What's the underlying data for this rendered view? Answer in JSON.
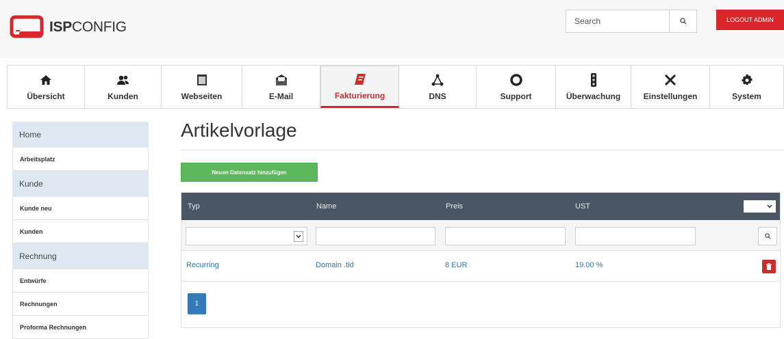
{
  "brand": {
    "bold": "ISP",
    "rest": "CONFIG"
  },
  "search": {
    "placeholder": "Search"
  },
  "logout_label": "LOGOUT ADMIN",
  "nav": [
    {
      "label": "Übersicht",
      "icon": "home-icon"
    },
    {
      "label": "Kunden",
      "icon": "users-icon"
    },
    {
      "label": "Webseiten",
      "icon": "browser-icon"
    },
    {
      "label": "E-Mail",
      "icon": "mail-icon"
    },
    {
      "label": "Fakturierung",
      "icon": "invoice-icon",
      "active": true
    },
    {
      "label": "DNS",
      "icon": "network-icon"
    },
    {
      "label": "Support",
      "icon": "lifebuoy-icon"
    },
    {
      "label": "Überwachung",
      "icon": "traffic-light-icon"
    },
    {
      "label": "Einstellungen",
      "icon": "tools-icon"
    },
    {
      "label": "System",
      "icon": "gear-icon"
    }
  ],
  "sidebar": [
    {
      "type": "head",
      "label": "Home"
    },
    {
      "type": "item",
      "label": "Arbeitsplatz"
    },
    {
      "type": "head",
      "label": "Kunde"
    },
    {
      "type": "item",
      "label": "Kunde neu"
    },
    {
      "type": "item",
      "label": "Kunden"
    },
    {
      "type": "head",
      "label": "Rechnung"
    },
    {
      "type": "item",
      "label": "Entwürfe"
    },
    {
      "type": "item",
      "label": "Rechnungen"
    },
    {
      "type": "item",
      "label": "Proforma Rechnungen"
    }
  ],
  "main": {
    "title": "Artikelvorlage",
    "add_button": "Neuen Datensatz hinzufügen",
    "columns": [
      "Typ",
      "Name",
      "Preis",
      "UST"
    ],
    "rows": [
      {
        "typ": "Recurring",
        "name": "Domain .tld",
        "preis": "8 EUR",
        "ust": "19.00 %"
      }
    ],
    "current_page": "1"
  },
  "colors": {
    "accent": "#d9262a",
    "header": "#4a5663",
    "link": "#3176b5",
    "add": "#5cb85c"
  }
}
